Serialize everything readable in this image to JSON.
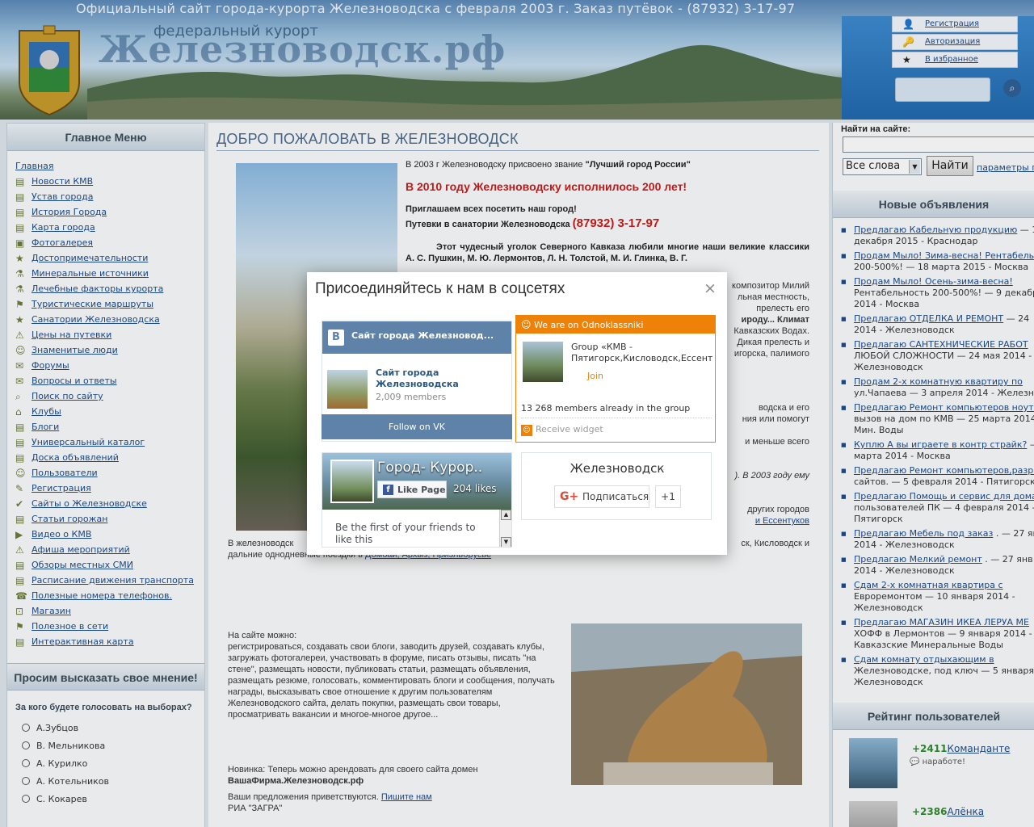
{
  "header": {
    "banner": "Официальный сайт города-курорта Железноводска с февраля 2003 г. Заказ путёвок - (87932) 3-17-97",
    "subtitle": "федеральный курорт",
    "site_title": "Железноводск.рф",
    "user_links": [
      "Регистрация",
      "Авторизация",
      "В избранное"
    ]
  },
  "menu": {
    "title": "Главное Меню",
    "items": [
      "Главная",
      "Новости КМВ",
      "Устав города",
      "История Города",
      "Карта города",
      "Фотогалерея",
      "Достопримечательности",
      "Минеральные источники",
      "Лечебные факторы курорта",
      "Туристические маршруты",
      "Санатории Железноводска",
      "Цены на путевки",
      "Знаменитые люди",
      "Форумы",
      "Вопросы и ответы",
      "Поиск по сайту",
      "Клубы",
      "Блоги",
      "Универсальный каталог",
      "Доска объявлений",
      "Пользователи",
      "Регистрация",
      "Сайты о Железноводске",
      "Статьи горожан",
      "Видео о КМВ",
      "Афиша мероприятий",
      "Обзоры местных СМИ",
      "Расписание движения транспорта",
      "Полезные номера телефонов.",
      "Магазин",
      "Полезное в сети",
      "Интерактивная карта"
    ]
  },
  "poll": {
    "title": "Просим высказать свое мнение!",
    "question": "За кого будете голосовать на выборах?",
    "options": [
      "А.Зубцов",
      "В. Мельникова",
      "А. Курилко",
      "А. Котельников",
      "С. Кокарев"
    ]
  },
  "center": {
    "title": "ДОБРО ПОЖАЛОВАТЬ В ЖЕЛЕЗНОВОДСК",
    "intro_line1_pre": "В 2003 г Железноводску присвоено звание ",
    "intro_line1_bold": "\"Лучший город России\"",
    "anniversary": "В 2010 году Железноводску исполнилось 200 лет!",
    "invite": "Приглашаем всех посетить наш город!",
    "vouchers_label": "Путевки в санатории Железноводска",
    "phone": "(87932) 3-17-97",
    "para1": "Этот чудесный уголок Северного Кавказа любили многие наши великие классики А. С. Пушкин, М. Ю. Лермонтов, Л. Н. Толстой, М. И. Глинка, В. Г.",
    "para1_tail_lines": [
      "композитор Милий",
      "льная местность,",
      "прелесть его",
      "ироду... Климат",
      "Кавказских Водах.",
      "Дикая прелесть и",
      "игорска, палимого"
    ],
    "para2_tail_lines": [
      "водска и его",
      "ния или помогут"
    ],
    "para3_tail": "и меньше всего",
    "para4_tail": "). В 2003 году ему",
    "para5_tail_lines": [
      "других городов",
      "и Ессентуков"
    ],
    "para6_left": "В железноводск",
    "para6_right": "ск, Кисловодск и",
    "para6_line2": "дальние однодневные поездки в",
    "para6_links": "Домбай, Архыз, Приэльбрусье",
    "can_title": "На сайте можно:",
    "can_text": "регистрироваться, создавать свои блоги, заводить друзей, создавать клубы, загружать фотогалереи, участвовать в форуме, писать отзывы, писать \"на стене\", размещать новости, публиковать статьи, размещать объявления, размещать резюме, голосовать, комментировать блоги и сообщения, получать награды, высказывать свое отношение к другим пользователям Железноводского сайта, делать покупки, размещать свои товары, просматривать вакансии и многое-многое другое...",
    "news_pre": "Новинка: Теперь можно арендовать для своего сайта домен",
    "news_domain": "ВашаФирма.Железноводск.рф",
    "suggest_pre": "Ваши предложения приветствуются. ",
    "suggest_link": "Пишите нам",
    "signature": "РИА \"ЗАГРА\""
  },
  "search": {
    "label": "Найти на сайте:",
    "value": "",
    "mode": "Все слова",
    "button": "Найти",
    "params": "параметры п"
  },
  "ads": {
    "title": "Новые объявления",
    "items": [
      {
        "link": "Предлагаю Кабельную продукцию",
        "meta": " — 1",
        "line2": "декабря 2015 - Краснодар"
      },
      {
        "link": "Продам Мыло! Зима-весна! Рентабельн",
        "meta": "",
        "line2": "200-500%! — 18 марта 2015 - Москва"
      },
      {
        "link": "Продам Мыло! Осень-зима-весна!",
        "meta": "",
        "line2": "Рентабельность 200-500%! — 9 декабр",
        "line3": "2014 - Москва"
      },
      {
        "link": "Предлагаю ОТДЕЛКА И РЕМОНТ",
        "meta": " — 24",
        "line2": "2014 - Железноводск"
      },
      {
        "link": "Предлагаю САНТЕХНИЧЕСКИЕ РАБОТ",
        "meta": "",
        "line2": "ЛЮБОЙ СЛОЖНОСТИ — 24 мая 2014 -",
        "line3": "Железноводск"
      },
      {
        "link": "Продам 2-х комнатную квартиру по",
        "meta": "",
        "line2": "ул.Чапаева — 3 апреля 2014 - Железно"
      },
      {
        "link": "Предлагаю Ремонт компьютеров ноутбу",
        "meta": "",
        "line2": "вызов на дом по КМВ — 25 марта 2014 -",
        "line3": "Мин. Воды"
      },
      {
        "link": "Куплю А вы играете в контр страйк?",
        "meta": " — 2",
        "line2": "марта 2014 - Москва"
      },
      {
        "link": "Предлагаю Ремонт компьютеров,разраб",
        "meta": "",
        "line2": "сайтов. — 5 февраля 2014 - Пятигорск"
      },
      {
        "link": "Предлагаю Помощь и сервис для домаш",
        "meta": "",
        "line2": "пользователей ПК — 4 февраля 2014 -",
        "line3": "Пятигорск"
      },
      {
        "link": "Предлагаю Мебель под заказ",
        "meta": " . — 27 янв",
        "line2": "2014 - Железноводск"
      },
      {
        "link": "Предлагаю Мелкий ремонт",
        "meta": " . — 27 янв",
        "line2": "2014 - Железноводск"
      },
      {
        "link": "Сдам 2-х комнатная квартира с",
        "meta": "",
        "line2": "Евроремонтом — 10 января 2014 -",
        "line3": "Железноводск"
      },
      {
        "link": "Предлагаю МАГАЗИН ИКЕА ЛЕРУА МЕ",
        "meta": "",
        "line2": "ХОФФ в Лермонтов — 9 января 2014 -",
        "line3": "Кавказские Минеральные Воды"
      },
      {
        "link": "Сдам комнату отдыхающим в",
        "meta": "",
        "line2": "Железноводске, под ключ — 5 января 2",
        "line3": "Железноводск"
      }
    ]
  },
  "rating": {
    "title": "Рейтинг пользователей",
    "items": [
      {
        "score": "+2411",
        "name": "Командантe",
        "msg": "наработе!"
      },
      {
        "score": "+2386",
        "name": "Алёнка",
        "msg": ""
      }
    ]
  },
  "modal": {
    "title": "Присоединяйтесь к нам в соцсетях",
    "close": "×",
    "vk": {
      "head": "Сайт города Железновод...",
      "name": "Сайт города Железноводска",
      "members": "2,009 members",
      "follow": "Follow on VK"
    },
    "ok": {
      "head": "We are on Odnoklassniki",
      "group": "Group «КМВ - Пятигорск,Кисловодск,Ессент",
      "join": "Join",
      "count": "13 268 members already in the group",
      "receive": "Receive widget"
    },
    "fb": {
      "name": "Город- Курор..",
      "like": "Like Page",
      "likes": "204 likes",
      "friends": "Be the first of your friends to like this"
    },
    "gp": {
      "name": "Железноводск",
      "follow": "Подписаться",
      "plus": "+1"
    }
  }
}
